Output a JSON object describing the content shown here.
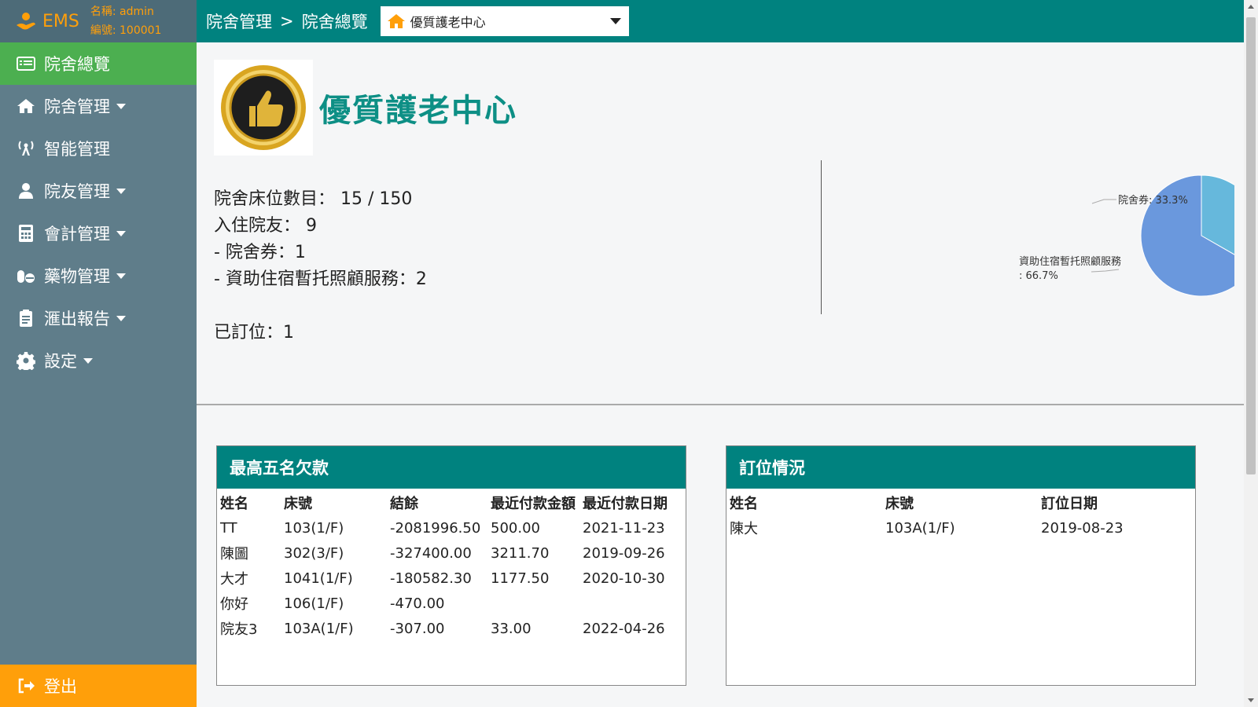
{
  "brand": {
    "name": "EMS",
    "user_label": "名稱: admin",
    "id_label": "編號: 100001"
  },
  "sidebar": {
    "items": [
      {
        "label": "院舍總覽",
        "icon": "list-icon",
        "caret": false
      },
      {
        "label": "院舍管理",
        "icon": "home-icon",
        "caret": true
      },
      {
        "label": "智能管理",
        "icon": "broadcast-icon",
        "caret": false
      },
      {
        "label": "院友管理",
        "icon": "user-icon",
        "caret": true
      },
      {
        "label": "會計管理",
        "icon": "calculator-icon",
        "caret": true
      },
      {
        "label": "藥物管理",
        "icon": "pills-icon",
        "caret": true
      },
      {
        "label": "滙出報告",
        "icon": "clipboard-icon",
        "caret": true
      },
      {
        "label": "設定",
        "icon": "gear-icon",
        "caret": true
      }
    ],
    "logout_label": "登出"
  },
  "topbar": {
    "crumb1": "院舍管理",
    "separator": ">",
    "crumb2": "院舍總覽",
    "selected_center": "優質護老中心"
  },
  "overview": {
    "center_name": "優質護老中心",
    "beds_label": "院舍床位數目：",
    "beds_value": "15 / 150",
    "residents_label": "入住院友：",
    "residents_value": "9",
    "voucher_line": "- 院舍券：1",
    "subsidy_line": "- 資助住宿暫托照顧服務：2",
    "booked_line": "已訂位：1"
  },
  "chart_data": {
    "type": "pie",
    "slices": [
      {
        "name": "院舍券",
        "label": "院舍券: 33.3%",
        "value": 33.3,
        "color": "#66b8dc"
      },
      {
        "name": "資助住宿暫托照顧服務",
        "label_line1": "資助住宿暫托照顧服務",
        "label_line2": ": 66.7%",
        "value": 66.7,
        "color": "#6a98dd"
      }
    ]
  },
  "debts": {
    "title": "最高五名欠款",
    "columns": [
      "姓名",
      "床號",
      "結餘",
      "最近付款金額",
      "最近付款日期"
    ],
    "rows": [
      [
        "TT",
        "103(1/F)",
        "-2081996.50",
        "500.00",
        "2021-11-23"
      ],
      [
        "陳圖",
        "302(3/F)",
        "-327400.00",
        "3211.70",
        "2019-09-26"
      ],
      [
        "大才",
        "1041(1/F)",
        "-180582.30",
        "1177.50",
        "2020-10-30"
      ],
      [
        "你好",
        "106(1/F)",
        "-470.00",
        "",
        ""
      ],
      [
        "院友3",
        "103A(1/F)",
        "-307.00",
        "33.00",
        "2022-04-26"
      ]
    ]
  },
  "bookings": {
    "title": "訂位情況",
    "columns": [
      "姓名",
      "床號",
      "訂位日期"
    ],
    "rows": [
      [
        "陳大",
        "103A(1/F)",
        "2019-08-23"
      ]
    ]
  }
}
